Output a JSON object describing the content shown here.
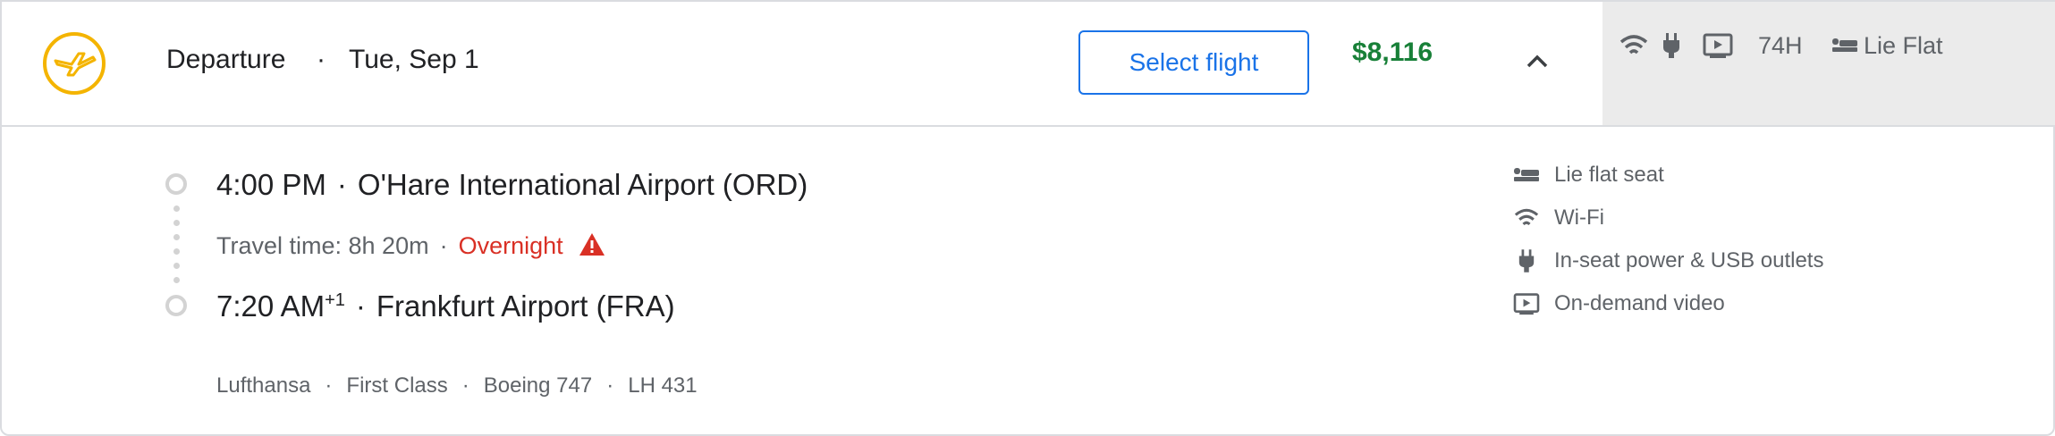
{
  "header": {
    "departure_label": "Departure",
    "separator": "·",
    "date": "Tue, Sep 1",
    "select_button": "Select flight",
    "price": "$8,116",
    "collapse_icon": "chevron-up-icon"
  },
  "amenity_bar": {
    "icons": [
      "wifi-icon",
      "power-plug-icon",
      "video-icon"
    ],
    "legroom": "74H",
    "seat_type": "Lie Flat",
    "seat_icon": "lie-flat-seat-icon"
  },
  "itinerary": {
    "departure_time": "4:00 PM",
    "departure_airport": "O'Hare International Airport (ORD)",
    "travel_time": "Travel time: 8h 20m",
    "overnight_label": "Overnight",
    "warning_icon": "warning-icon",
    "arrival_time": "7:20 AM",
    "arrival_day_offset": "+1",
    "arrival_airport": "Frankfurt Airport (FRA)",
    "dot": "·"
  },
  "meta": {
    "airline": "Lufthansa",
    "cabin": "First Class",
    "aircraft": "Boeing 747",
    "flight_number": "LH 431"
  },
  "features": [
    {
      "icon": "lie-flat-seat-icon",
      "label": "Lie flat seat"
    },
    {
      "icon": "wifi-icon",
      "label": "Wi-Fi"
    },
    {
      "icon": "power-plug-icon",
      "label": "In-seat power & USB outlets"
    },
    {
      "icon": "video-icon",
      "label": "On-demand video"
    }
  ],
  "colors": {
    "accent": "#1a73e8",
    "price": "#188038",
    "warning": "#d93025",
    "logo": "#f4b400"
  }
}
